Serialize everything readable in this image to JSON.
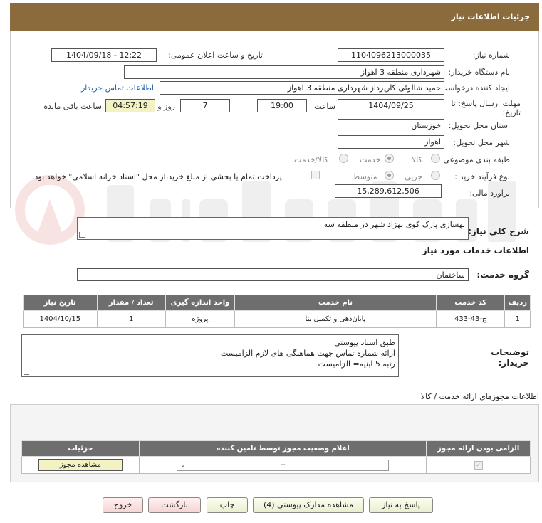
{
  "header": {
    "title": "جزئیات اطلاعات نیاز"
  },
  "form": {
    "need_number_label": "شماره نیاز:",
    "need_number": "1104096213000035",
    "announce_label": "تاریخ و ساعت اعلان عمومی:",
    "announce_value": "1404/09/18 - 12:22",
    "buyer_org_label": "نام دستگاه خریدار:",
    "buyer_org": "شهرداری منطقه 3 اهواز",
    "creator_label": "ایجاد کننده درخواست:",
    "creator": "حمید شالوئی کارپرداز شهرداری منطقه 3 اهواز",
    "contact_link": "اطلاعات تماس خریدار",
    "deadline_label_1": "مهلت ارسال پاسخ: تا",
    "deadline_label_2": "تاریخ:",
    "deadline_date": "1404/09/25",
    "time_label": "ساعت",
    "deadline_time": "19:00",
    "days_value": "7",
    "days_label": "روز و",
    "remaining_time": "04:57:19",
    "remaining_label": "ساعت باقی مانده",
    "province_label": "استان محل تحویل:",
    "province": "خوزستان",
    "city_label": "شهر محل تحویل:",
    "city": "اهواز",
    "category_label": "طبقه بندی موضوعی:",
    "category_options": [
      "کالا",
      "خدمت",
      "کالا/خدمت"
    ],
    "category_selected": "خدمت",
    "purchase_type_label": "نوع فرآیند خرید :",
    "purchase_options": [
      "جزیی",
      "متوسط"
    ],
    "purchase_selected": "متوسط",
    "payment_note": "پرداخت تمام یا بخشی از مبلغ خرید،از محل \"اسناد خزانه اسلامی\" خواهد بود.",
    "estimate_label": "برآورد مالی:",
    "estimate": "15,289,612,506"
  },
  "summary": {
    "label": "شرح کلي نياز:",
    "text": "بهسازی پارک کوی بهزاد شهر در منطقه سه"
  },
  "services": {
    "section_title": "اطلاعات خدمات مورد نیاز",
    "group_label": "گروه خدمت:",
    "group_value": "ساختمان",
    "columns": [
      "ردیف",
      "کد خدمت",
      "نام خدمت",
      "واحد اندازه گیری",
      "تعداد / مقدار",
      "تاریخ نیاز"
    ],
    "rows": [
      {
        "row": "1",
        "code": "ج-43-433",
        "name": "پایان‌دهی و تکمیل بنا",
        "unit": "پروژه",
        "qty": "1",
        "date": "1404/10/15"
      }
    ]
  },
  "buyer_notes": {
    "label_1": "توضیحات",
    "label_2": "خریدار:",
    "lines": [
      "طبق اسناد پیوستی",
      "ارائه شماره تماس جهت هماهنگی های لازم الزامیست",
      "رتبه 5 ابنیه= الزامیست"
    ]
  },
  "permits": {
    "section_title": "اطلاعات مجوزهای ارائه خدمت / کالا",
    "columns": [
      "الزامی بودن ارائه مجوز",
      "اعلام وضعیت مجوز توسط تامین کننده",
      "جزئیات"
    ],
    "select_value": "--",
    "view_button": "مشاهده مجوز"
  },
  "footer": {
    "reply": "پاسخ به نیاز",
    "attachments": "مشاهده مدارک پیوستی (4)",
    "print": "چاپ",
    "back": "بازگشت",
    "exit": "خروج"
  },
  "colors": {
    "header_bg": "#8b6a3c",
    "table_header_bg": "#6e6e6e",
    "link": "#1e5fb3",
    "highlight": "#f3f2c3"
  }
}
